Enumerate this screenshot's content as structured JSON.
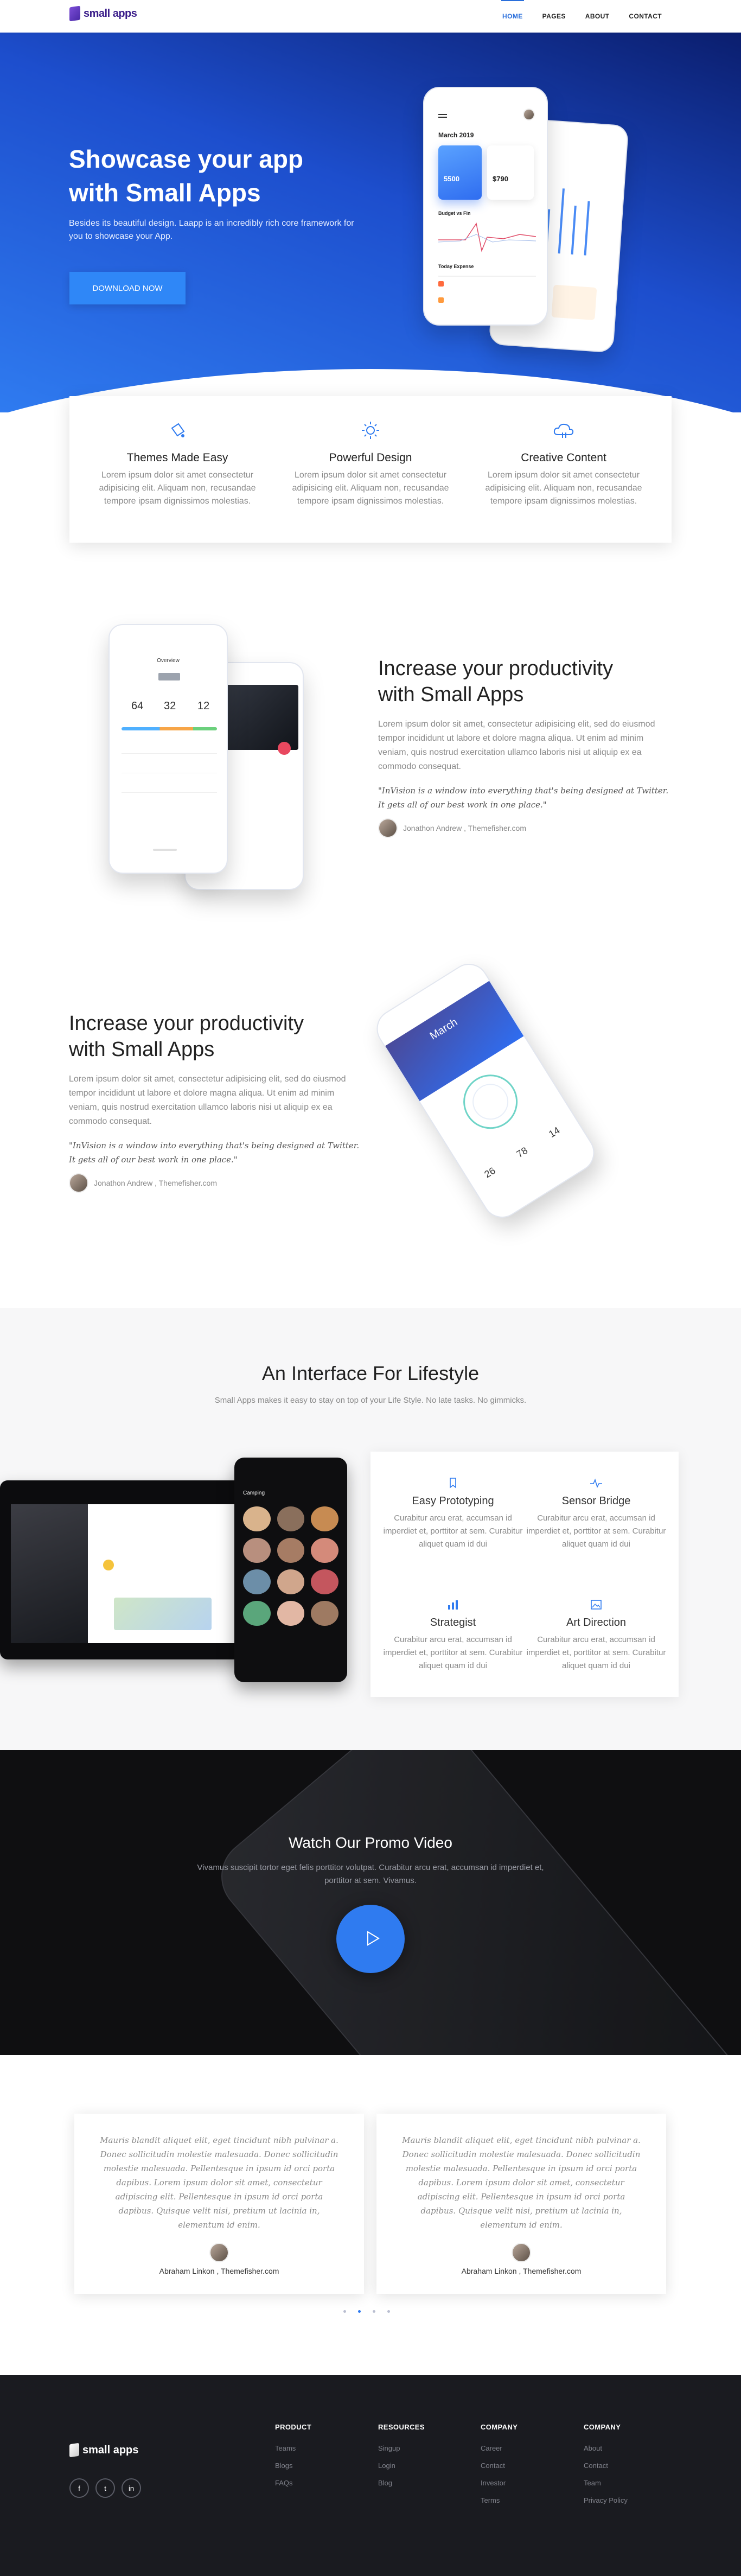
{
  "brand": {
    "name": "small apps",
    "accent": "#2f7bf0"
  },
  "nav": {
    "items": [
      "HOME",
      "PAGES",
      "ABOUT",
      "CONTACT"
    ]
  },
  "hero": {
    "title_line1": "Showcase your app",
    "title_line2": "with Small Apps",
    "text": "Besides its beautiful design. Laapp is an incredibly rich core framework for you to showcase your App.",
    "button": "DOWNLOAD NOW",
    "phone": {
      "month": "March 2019",
      "card1_value": "5500",
      "card2_value": "$790",
      "section": "Budget vs Fin",
      "section2": "Today Expense"
    }
  },
  "features": [
    {
      "icon": "bucket-icon",
      "title": "Themes Made Easy",
      "text": "Lorem ipsum dolor sit amet consectetur adipisicing elit. Aliquam non, recusandae tempore ipsam dignissimos molestias."
    },
    {
      "icon": "sun-icon",
      "title": "Powerful Design",
      "text": "Lorem ipsum dolor sit amet consectetur adipisicing elit. Aliquam non, recusandae tempore ipsam dignissimos molestias."
    },
    {
      "icon": "cloud-icon",
      "title": "Creative Content",
      "text": "Lorem ipsum dolor sit amet consectetur adipisicing elit. Aliquam non, recusandae tempore ipsam dignissimos molestias."
    }
  ],
  "section1": {
    "title_line1": "Increase your productivity",
    "title_line2": "with Small Apps",
    "text": "Lorem ipsum dolor sit amet, consectetur adipisicing elit, sed do eiusmod tempor incididunt ut labore et dolore magna aliqua. Ut enim ad minim veniam, quis nostrud exercitation ullamco laboris nisi ut aliquip ex ea commodo consequat.",
    "quote": "\"InVision is a window into everything that's being designed at Twitter. It gets all of our best work in one place.\"",
    "author": "Jonathon Andrew , Themefisher.com",
    "phone": {
      "title": "Overview",
      "n1": "64",
      "n2": "32",
      "n3": "12"
    }
  },
  "section2": {
    "title_line1": "Increase your productivity",
    "title_line2": "with Small Apps",
    "text": "Lorem ipsum dolor sit amet, consectetur adipisicing elit, sed do eiusmod tempor incididunt ut labore et dolore magna aliqua. Ut enim ad minim veniam, quis nostrud exercitation ullamco laboris nisi ut aliquip ex ea commodo consequat.",
    "quote": "\"InVision is a window into everything that's being designed at Twitter. It gets all of our best work in one place.\"",
    "author": "Jonathon Andrew , Themefisher.com",
    "phone": {
      "month": "March",
      "n1": "26",
      "n2": "78",
      "n3": "14"
    }
  },
  "lifestyle": {
    "title": "An Interface For Lifestyle",
    "subtitle": "Small Apps makes it easy to stay on top of your Life Style. No late tasks. No gimmicks.",
    "items": [
      {
        "icon": "bookmark-icon",
        "title": "Easy Prototyping",
        "text": "Curabitur arcu erat, accumsan id imperdiet et, porttitor at sem. Curabitur aliquet quam id dui"
      },
      {
        "icon": "pulse-icon",
        "title": "Sensor Bridge",
        "text": "Curabitur arcu erat, accumsan id imperdiet et, porttitor at sem. Curabitur aliquet quam id dui"
      },
      {
        "icon": "bar-chart-icon",
        "title": "Strategist",
        "text": "Curabitur arcu erat, accumsan id imperdiet et, porttitor at sem. Curabitur aliquet quam id dui"
      },
      {
        "icon": "image-icon",
        "title": "Art Direction",
        "text": "Curabitur arcu erat, accumsan id imperdiet et, porttitor at sem. Curabitur aliquet quam id dui"
      }
    ],
    "phone_title": "Camping"
  },
  "video": {
    "title": "Watch Our Promo Video",
    "text": "Vivamus suscipit tortor eget felis porttitor volutpat. Curabitur arcu erat, accumsan id imperdiet et, porttitor at sem. Vivamus."
  },
  "testimonials": [
    {
      "quote": "Mauris blandit aliquet elit, eget tincidunt nibh pulvinar a. Donec sollicitudin molestie malesuada. Donec sollicitudin molestie malesuada. Pellentesque in ipsum id orci porta dapibus. Lorem ipsum dolor sit amet, consectetur adipiscing elit. Pellentesque in ipsum id orci porta dapibus. Quisque velit nisi, pretium ut lacinia in, elementum id enim.",
      "name": "Abraham Linkon , Themefisher.com"
    },
    {
      "quote": "Mauris blandit aliquet elit, eget tincidunt nibh pulvinar a. Donec sollicitudin molestie malesuada. Donec sollicitudin molestie malesuada. Pellentesque in ipsum id orci porta dapibus. Lorem ipsum dolor sit amet, consectetur adipiscing elit. Pellentesque in ipsum id orci porta dapibus. Quisque velit nisi, pretium ut lacinia in, elementum id enim.",
      "name": "Abraham Linkon , Themefisher.com"
    }
  ],
  "footer": {
    "columns": [
      {
        "title": "PRODUCT",
        "links": [
          "Teams",
          "Blogs",
          "FAQs"
        ]
      },
      {
        "title": "RESOURCES",
        "links": [
          "Singup",
          "Login",
          "Blog"
        ]
      },
      {
        "title": "COMPANY",
        "links": [
          "Career",
          "Contact",
          "Investor",
          "Terms"
        ]
      },
      {
        "title": "COMPANY",
        "links": [
          "About",
          "Contact",
          "Team",
          "Privacy Policy"
        ]
      }
    ],
    "social": [
      "f",
      "t",
      "in"
    ]
  }
}
